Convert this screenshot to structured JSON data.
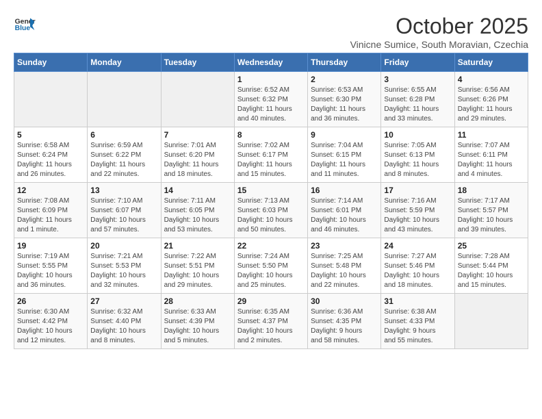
{
  "header": {
    "logo_line1": "General",
    "logo_line2": "Blue",
    "month": "October 2025",
    "location": "Vinicne Sumice, South Moravian, Czechia"
  },
  "days_of_week": [
    "Sunday",
    "Monday",
    "Tuesday",
    "Wednesday",
    "Thursday",
    "Friday",
    "Saturday"
  ],
  "weeks": [
    [
      {
        "day": "",
        "info": ""
      },
      {
        "day": "",
        "info": ""
      },
      {
        "day": "",
        "info": ""
      },
      {
        "day": "1",
        "info": "Sunrise: 6:52 AM\nSunset: 6:32 PM\nDaylight: 11 hours\nand 40 minutes."
      },
      {
        "day": "2",
        "info": "Sunrise: 6:53 AM\nSunset: 6:30 PM\nDaylight: 11 hours\nand 36 minutes."
      },
      {
        "day": "3",
        "info": "Sunrise: 6:55 AM\nSunset: 6:28 PM\nDaylight: 11 hours\nand 33 minutes."
      },
      {
        "day": "4",
        "info": "Sunrise: 6:56 AM\nSunset: 6:26 PM\nDaylight: 11 hours\nand 29 minutes."
      }
    ],
    [
      {
        "day": "5",
        "info": "Sunrise: 6:58 AM\nSunset: 6:24 PM\nDaylight: 11 hours\nand 26 minutes."
      },
      {
        "day": "6",
        "info": "Sunrise: 6:59 AM\nSunset: 6:22 PM\nDaylight: 11 hours\nand 22 minutes."
      },
      {
        "day": "7",
        "info": "Sunrise: 7:01 AM\nSunset: 6:20 PM\nDaylight: 11 hours\nand 18 minutes."
      },
      {
        "day": "8",
        "info": "Sunrise: 7:02 AM\nSunset: 6:17 PM\nDaylight: 11 hours\nand 15 minutes."
      },
      {
        "day": "9",
        "info": "Sunrise: 7:04 AM\nSunset: 6:15 PM\nDaylight: 11 hours\nand 11 minutes."
      },
      {
        "day": "10",
        "info": "Sunrise: 7:05 AM\nSunset: 6:13 PM\nDaylight: 11 hours\nand 8 minutes."
      },
      {
        "day": "11",
        "info": "Sunrise: 7:07 AM\nSunset: 6:11 PM\nDaylight: 11 hours\nand 4 minutes."
      }
    ],
    [
      {
        "day": "12",
        "info": "Sunrise: 7:08 AM\nSunset: 6:09 PM\nDaylight: 11 hours\nand 1 minute."
      },
      {
        "day": "13",
        "info": "Sunrise: 7:10 AM\nSunset: 6:07 PM\nDaylight: 10 hours\nand 57 minutes."
      },
      {
        "day": "14",
        "info": "Sunrise: 7:11 AM\nSunset: 6:05 PM\nDaylight: 10 hours\nand 53 minutes."
      },
      {
        "day": "15",
        "info": "Sunrise: 7:13 AM\nSunset: 6:03 PM\nDaylight: 10 hours\nand 50 minutes."
      },
      {
        "day": "16",
        "info": "Sunrise: 7:14 AM\nSunset: 6:01 PM\nDaylight: 10 hours\nand 46 minutes."
      },
      {
        "day": "17",
        "info": "Sunrise: 7:16 AM\nSunset: 5:59 PM\nDaylight: 10 hours\nand 43 minutes."
      },
      {
        "day": "18",
        "info": "Sunrise: 7:17 AM\nSunset: 5:57 PM\nDaylight: 10 hours\nand 39 minutes."
      }
    ],
    [
      {
        "day": "19",
        "info": "Sunrise: 7:19 AM\nSunset: 5:55 PM\nDaylight: 10 hours\nand 36 minutes."
      },
      {
        "day": "20",
        "info": "Sunrise: 7:21 AM\nSunset: 5:53 PM\nDaylight: 10 hours\nand 32 minutes."
      },
      {
        "day": "21",
        "info": "Sunrise: 7:22 AM\nSunset: 5:51 PM\nDaylight: 10 hours\nand 29 minutes."
      },
      {
        "day": "22",
        "info": "Sunrise: 7:24 AM\nSunset: 5:50 PM\nDaylight: 10 hours\nand 25 minutes."
      },
      {
        "day": "23",
        "info": "Sunrise: 7:25 AM\nSunset: 5:48 PM\nDaylight: 10 hours\nand 22 minutes."
      },
      {
        "day": "24",
        "info": "Sunrise: 7:27 AM\nSunset: 5:46 PM\nDaylight: 10 hours\nand 18 minutes."
      },
      {
        "day": "25",
        "info": "Sunrise: 7:28 AM\nSunset: 5:44 PM\nDaylight: 10 hours\nand 15 minutes."
      }
    ],
    [
      {
        "day": "26",
        "info": "Sunrise: 6:30 AM\nSunset: 4:42 PM\nDaylight: 10 hours\nand 12 minutes."
      },
      {
        "day": "27",
        "info": "Sunrise: 6:32 AM\nSunset: 4:40 PM\nDaylight: 10 hours\nand 8 minutes."
      },
      {
        "day": "28",
        "info": "Sunrise: 6:33 AM\nSunset: 4:39 PM\nDaylight: 10 hours\nand 5 minutes."
      },
      {
        "day": "29",
        "info": "Sunrise: 6:35 AM\nSunset: 4:37 PM\nDaylight: 10 hours\nand 2 minutes."
      },
      {
        "day": "30",
        "info": "Sunrise: 6:36 AM\nSunset: 4:35 PM\nDaylight: 9 hours\nand 58 minutes."
      },
      {
        "day": "31",
        "info": "Sunrise: 6:38 AM\nSunset: 4:33 PM\nDaylight: 9 hours\nand 55 minutes."
      },
      {
        "day": "",
        "info": ""
      }
    ]
  ]
}
